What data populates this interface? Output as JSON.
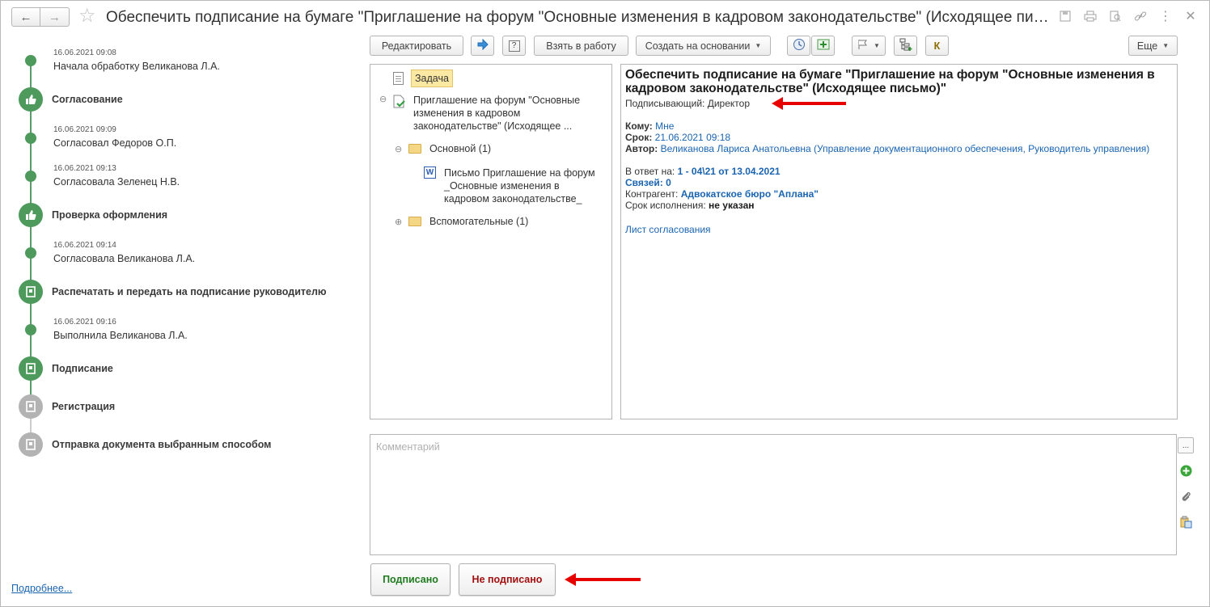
{
  "window": {
    "title": "Обеспечить подписание на бумаге \"Приглашение на форум \"Основные изменения в кадровом законодательстве\" (Исходящее пис..."
  },
  "timeline": {
    "events": [
      {
        "date": "16.06.2021 09:08",
        "text": "Начала обработку Великанова Л.А."
      },
      {
        "date": "16.06.2021 09:09",
        "text": "Согласовал Федоров О.П."
      },
      {
        "date": "16.06.2021 09:13",
        "text": "Согласовала Зеленец Н.В."
      },
      {
        "date": "16.06.2021 09:14",
        "text": "Согласовала Великанова Л.А."
      },
      {
        "date": "16.06.2021 09:16",
        "text": "Выполнила Великанова Л.А."
      }
    ],
    "steps": [
      {
        "label": "Согласование",
        "icon": "thumbs-up-icon"
      },
      {
        "label": "Проверка оформления",
        "icon": "thumbs-up-icon"
      },
      {
        "label": "Распечатать и передать на подписание руководителю",
        "icon": "document-icon"
      },
      {
        "label": "Подписание",
        "icon": "document-icon"
      },
      {
        "label": "Регистрация",
        "icon": "document-icon"
      },
      {
        "label": "Отправка документа выбранным способом",
        "icon": "document-icon"
      }
    ],
    "more_link": "Подробнее..."
  },
  "toolbar": {
    "edit": "Редактировать",
    "take": "Взять в работу",
    "create_based": "Создать на основании",
    "more": "Еще",
    "k_label": "К"
  },
  "tree": {
    "task": "Задача",
    "item1": "Приглашение на форум \"Основные изменения в кадровом законодательстве\" (Исходящее ...",
    "folder_main": "Основной (1)",
    "file": "Письмо Приглашение на форум _Основные изменения в кадровом законодательстве_",
    "folder_aux": "Вспомогательные (1)"
  },
  "info": {
    "title": "Обеспечить подписание на бумаге \"Приглашение на форум \"Основные изменения в кадровом законодательстве\" (Исходящее письмо)\"",
    "signer": "Подписывающий: Директор",
    "to_label": "Кому:",
    "to_value": "Мне",
    "due_label": "Срок:",
    "due_value": "21.06.2021 09:18",
    "author_label": "Автор:",
    "author_value": "Великанова Лариса Анатольевна (Управление документационного обеспечения, Руководитель управления)",
    "reply_label": "В ответ на:",
    "reply_value": "1 - 04\\21 от 13.04.2021",
    "links": "Связей: 0",
    "contractor_label": "Контрагент:",
    "contractor_value": "Адвокатское бюро \"Аплана\"",
    "exec_label": "Срок исполнения:",
    "exec_value": "не указан",
    "approval_sheet": "Лист согласования"
  },
  "comment": {
    "placeholder": "Комментарий",
    "more": "..."
  },
  "actions": {
    "signed": "Подписано",
    "not_signed": "Не подписано"
  },
  "colors": {
    "green": "#4e9a5d",
    "grey": "#b3b3b3",
    "link": "#1a64b0",
    "arrow": "#e60000",
    "signed": "#1f7a1f",
    "not_signed": "#a01010"
  }
}
